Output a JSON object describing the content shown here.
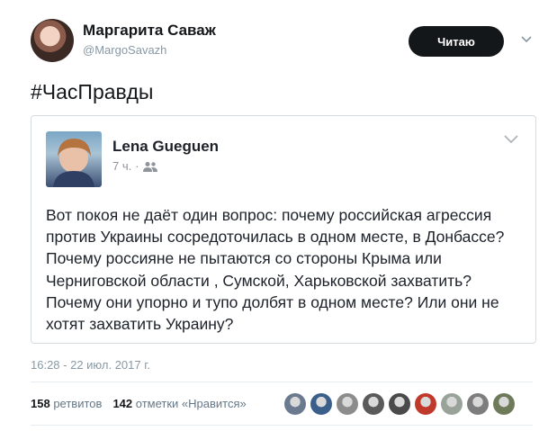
{
  "author": {
    "display_name": "Маргарита Саваж",
    "handle": "@MargoSavazh",
    "follow_label": "Читаю"
  },
  "tweet": {
    "text": "#ЧасПравды"
  },
  "quoted_post": {
    "author_name": "Lena Gueguen",
    "time": "7 ч.",
    "body": "Вот покоя не даёт один вопрос: почему российская агрессия против Украины сосредоточилась в одном месте, в Донбассе? Почему россияне не пытаются со стороны Крыма или Черниговской области , Сумской, Харьковской захватить? Почему они упорно и тупо долбят в одном месте? Или они не хотят захватить Украину?"
  },
  "timestamp": "16:28 - 22 июл. 2017 г.",
  "stats": {
    "retweets_count": "158",
    "retweets_label": "ретвитов",
    "likes_count": "142",
    "likes_label": "отметки «Нравится»"
  },
  "liker_colors": [
    "#6b7a8f",
    "#3a5f8a",
    "#8c8c8c",
    "#5a5a5a",
    "#4a4a4a",
    "#c0392b",
    "#9aa39a",
    "#7d7d7d",
    "#6f7a5a"
  ]
}
